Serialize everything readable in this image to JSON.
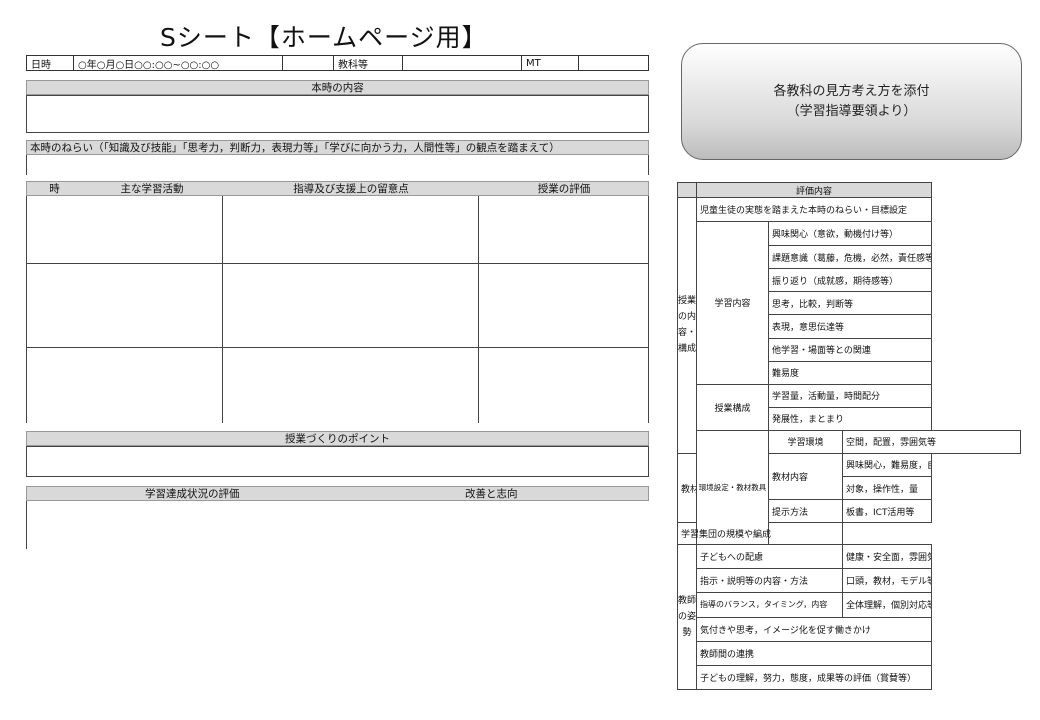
{
  "title": "Sシート【ホームページ用】",
  "header": {
    "date_label": "日時",
    "date_value": "○年○月○日○○:○○~○○:○○",
    "subject_label": "教科等",
    "subject_value": "",
    "mt_label": "MT",
    "mt_value": ""
  },
  "sections": {
    "lesson_content": "本時の内容",
    "aim": "本時のねらい（「知識及び技能」「思考力，判断力，表現力等」「学びに向かう力，人間性等」の観点を踏まえて）",
    "points": "授業づくりのポイント",
    "achievement": "学習達成状況の評価",
    "improvement": "改善と志向"
  },
  "activity_table": {
    "columns": [
      "時",
      "主な学習活動",
      "指導及び支援上の留意点",
      "授業の評価"
    ]
  },
  "callout": {
    "line1": "各教科の見方考え方を添付",
    "line2": "（学習指導要領より）"
  },
  "eval_table": {
    "header": "評価内容",
    "groups": {
      "lesson": "授業の内容・構成",
      "environment": "環境設定・教材教具",
      "teacher": "教師の姿勢"
    },
    "rows": {
      "r1": "児童生徒の実態を踏まえた本時のねらい・目標設定",
      "learning_content": "学習内容",
      "lc_items": [
        "興味関心（意欲，動機付け等）",
        "課題意識（葛藤，危機，必然，責任感等）",
        "振り返り（成就感，期待感等）",
        "思考，比較，判断等",
        "表現，意思伝達等",
        "他学習・場面等との関連",
        "難易度"
      ],
      "structure": "授業構成",
      "structure_items": [
        "学習量，活動量，時間配分",
        "発展性，まとまり"
      ],
      "environment_label": "学習環境",
      "environment_value": "空間，配置，雰囲気等",
      "materials": "教材・提示",
      "materials_content": "教材内容",
      "mc_items": [
        "興味関心，難易度，自由度",
        "対象，操作性，量"
      ],
      "presentation": "提示方法",
      "presentation_value": "板書，ICT活用等",
      "group_size": "学習集団の規模や編成",
      "consideration": "子どもへの配慮",
      "consideration_value": "健康・安全面，雰囲気，言葉，気付き等",
      "instruction": "指示・説明等の内容・方法",
      "instruction_value": "口頭，教材，モデル等",
      "balance": "指導のバランス，タイミング，内容",
      "balance_value": "全体理解，個別対応等",
      "prompting": "気付きや思考，イメージ化を促す働きかけ",
      "cooperation": "教師間の連携",
      "understanding": "子どもの理解，努力，態度，成果等の評価（賞賛等）"
    }
  }
}
